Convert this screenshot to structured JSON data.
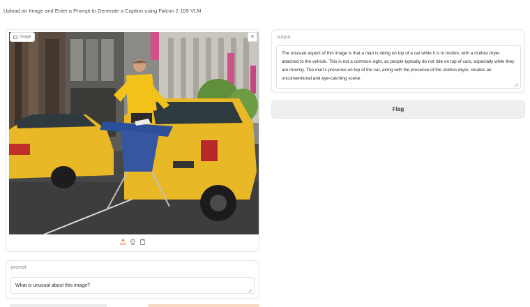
{
  "header": {
    "title": "Upload an Image and Enter a Prompt to Generate a Caption using Falcon 2 11B VLM"
  },
  "image_panel": {
    "label": "Image",
    "close_symbol": "×",
    "tools": [
      "upload-icon",
      "webcam-icon",
      "clipboard-icon"
    ]
  },
  "prompt": {
    "label": "prompt",
    "value": "What is unusual about this image?"
  },
  "output": {
    "label": "output",
    "text": "The unusual aspect of this image is that a man is riding on top of a car while it is in motion, with a clothes dryer attached to the vehicle. This is not a common sight, as people typically do not ride on top of cars, especially while they are moving. The man's presence on top of the car, along with the presence of the clothes dryer, creates an unconventional and eye-catching scene."
  },
  "flag": {
    "label": "Flag"
  },
  "colors": {
    "taxi_yellow": "#e9b826",
    "accent_orange": "#f8d9c4",
    "button_bg": "#eeeff1"
  }
}
